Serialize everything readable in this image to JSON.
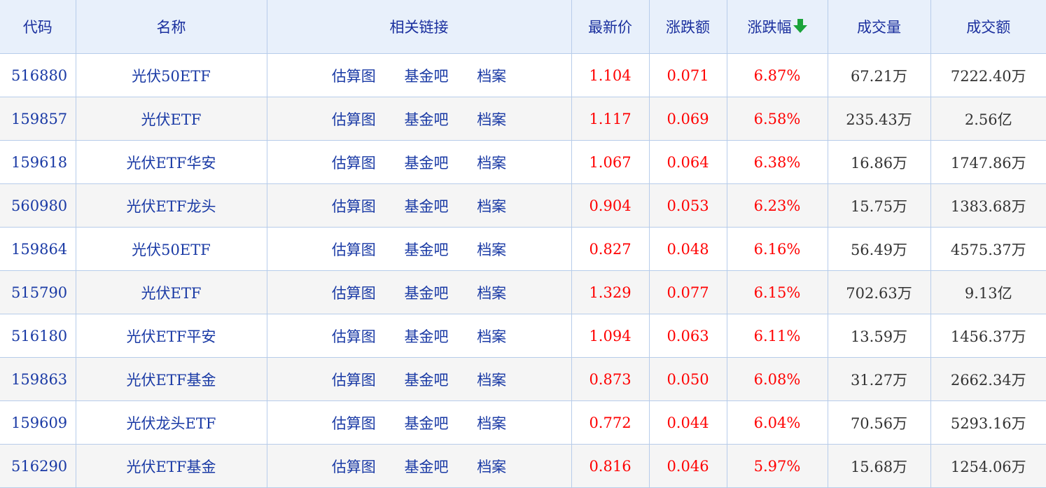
{
  "headers": {
    "code": "代码",
    "name": "名称",
    "links": "相关链接",
    "price": "最新价",
    "change": "涨跌额",
    "change_pct": "涨跌幅",
    "volume": "成交量",
    "amount": "成交额"
  },
  "link_labels": {
    "chart": "估算图",
    "forum": "基金吧",
    "profile": "档案"
  },
  "colors": {
    "up": "#ff0000",
    "link": "#1a3aa5",
    "header_bg": "#e8f0fb",
    "sort_arrow": "#1aa33a"
  },
  "sort_icon": "arrow-down-icon",
  "rows": [
    {
      "code": "516880",
      "name": "光伏50ETF",
      "price": "1.104",
      "change": "0.071",
      "change_pct": "6.87%",
      "volume": "67.21万",
      "amount": "7222.40万"
    },
    {
      "code": "159857",
      "name": "光伏ETF",
      "price": "1.117",
      "change": "0.069",
      "change_pct": "6.58%",
      "volume": "235.43万",
      "amount": "2.56亿"
    },
    {
      "code": "159618",
      "name": "光伏ETF华安",
      "price": "1.067",
      "change": "0.064",
      "change_pct": "6.38%",
      "volume": "16.86万",
      "amount": "1747.86万"
    },
    {
      "code": "560980",
      "name": "光伏ETF龙头",
      "price": "0.904",
      "change": "0.053",
      "change_pct": "6.23%",
      "volume": "15.75万",
      "amount": "1383.68万"
    },
    {
      "code": "159864",
      "name": "光伏50ETF",
      "price": "0.827",
      "change": "0.048",
      "change_pct": "6.16%",
      "volume": "56.49万",
      "amount": "4575.37万"
    },
    {
      "code": "515790",
      "name": "光伏ETF",
      "price": "1.329",
      "change": "0.077",
      "change_pct": "6.15%",
      "volume": "702.63万",
      "amount": "9.13亿"
    },
    {
      "code": "516180",
      "name": "光伏ETF平安",
      "price": "1.094",
      "change": "0.063",
      "change_pct": "6.11%",
      "volume": "13.59万",
      "amount": "1456.37万"
    },
    {
      "code": "159863",
      "name": "光伏ETF基金",
      "price": "0.873",
      "change": "0.050",
      "change_pct": "6.08%",
      "volume": "31.27万",
      "amount": "2662.34万"
    },
    {
      "code": "159609",
      "name": "光伏龙头ETF",
      "price": "0.772",
      "change": "0.044",
      "change_pct": "6.04%",
      "volume": "70.56万",
      "amount": "5293.16万"
    },
    {
      "code": "516290",
      "name": "光伏ETF基金",
      "price": "0.816",
      "change": "0.046",
      "change_pct": "5.97%",
      "volume": "15.68万",
      "amount": "1254.06万"
    }
  ]
}
